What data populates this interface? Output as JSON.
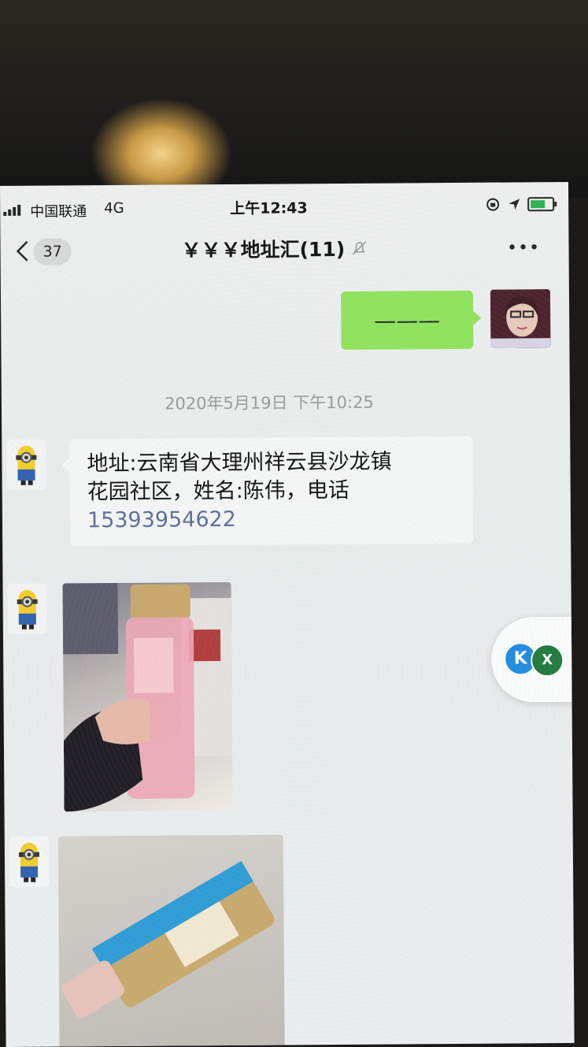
{
  "status_bar": {
    "carrier": "中国联通",
    "network": "4G",
    "time": "上午12:43"
  },
  "nav": {
    "back_count": "37",
    "title": "￥￥￥地址汇(11)"
  },
  "messages": {
    "me_text": "———",
    "timestamp": "2020年5月19日 下午10:25",
    "address_line1": "地址:云南省大理州祥云县沙龙镇",
    "address_line2": "花园社区，姓名:陈伟，电话",
    "phone": "15393954622"
  },
  "floating_widget": {
    "k_label": "K",
    "x_label": "X"
  },
  "colors": {
    "my_bubble": "#8fe35c",
    "phone_link": "#5a6e9a",
    "battery": "#2ab34a"
  }
}
